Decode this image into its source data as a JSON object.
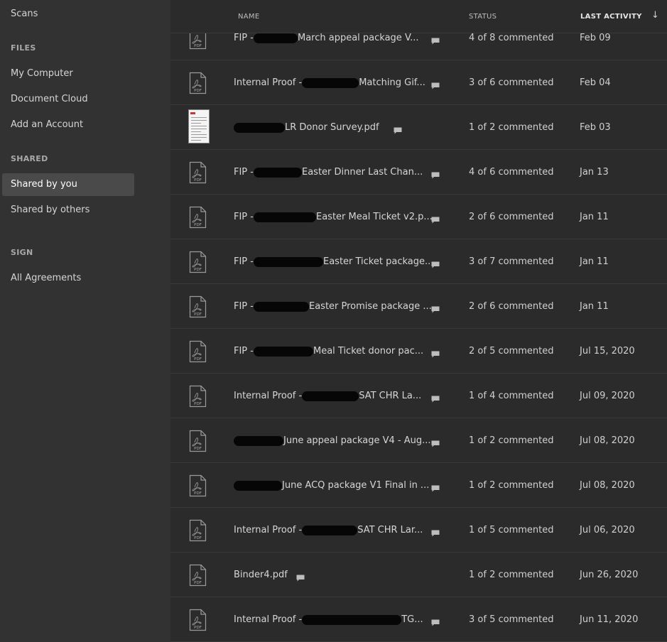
{
  "sidebar": {
    "top_item": "Scans",
    "sections": {
      "files": "FILES",
      "shared": "SHARED",
      "sign": "SIGN"
    },
    "files_items": [
      "My Computer",
      "Document Cloud",
      "Add an Account"
    ],
    "shared_items": [
      "Shared by you",
      "Shared by others"
    ],
    "sign_items": [
      "All Agreements"
    ],
    "active_item": "Shared by you"
  },
  "header": {
    "name": "NAME",
    "status": "STATUS",
    "last_activity": "LAST ACTIVITY",
    "sort_icon": "arrow-down-icon"
  },
  "files": [
    {
      "prefix": "FIP - ",
      "suffix": " March appeal package V...",
      "status": "4 of 8 commented",
      "activity": "Feb 09",
      "thumb": false
    },
    {
      "prefix": "Internal Proof - ",
      "suffix": " Matching Gif...",
      "status": "3 of 6 commented",
      "activity": "Feb 04",
      "thumb": false
    },
    {
      "prefix": "",
      "suffix": " LR Donor Survey.pdf",
      "status": "1 of 2 commented",
      "activity": "Feb 03",
      "thumb": true
    },
    {
      "prefix": "FIP - ",
      "suffix": " Easter Dinner Last Chan...",
      "status": "4 of 6 commented",
      "activity": "Jan 13",
      "thumb": false
    },
    {
      "prefix": "FIP - ",
      "suffix": " Easter Meal Ticket v2.p...",
      "status": "2 of 6 commented",
      "activity": "Jan 11",
      "thumb": false
    },
    {
      "prefix": "FIP - ",
      "suffix": " Easter Ticket package...",
      "status": "3 of 7 commented",
      "activity": "Jan 11",
      "thumb": false
    },
    {
      "prefix": "FIP - ",
      "suffix": " Easter Promise package ...",
      "status": "2 of 6 commented",
      "activity": "Jan 11",
      "thumb": false
    },
    {
      "prefix": "FIP - ",
      "suffix": " Meal Ticket donor pac...",
      "status": "2 of 5 commented",
      "activity": "Jul 15, 2020",
      "thumb": false
    },
    {
      "prefix": "Internal Proof - ",
      "suffix": " SAT CHR La...",
      "status": "1 of 4 commented",
      "activity": "Jul 09, 2020",
      "thumb": false
    },
    {
      "prefix": "",
      "suffix": " June appeal package V4 - Aug...",
      "status": "1 of 2 commented",
      "activity": "Jul 08, 2020",
      "thumb": false
    },
    {
      "prefix": "",
      "suffix": " June ACQ package V1 Final in ...",
      "status": "1 of 2 commented",
      "activity": "Jul 08, 2020",
      "thumb": false
    },
    {
      "prefix": "Internal Proof - ",
      "suffix": " SAT CHR Lar...",
      "status": "1 of 5 commented",
      "activity": "Jul 06, 2020",
      "thumb": false
    },
    {
      "prefix": "Binder4.pdf",
      "suffix": "",
      "status": "1 of 2 commented",
      "activity": "Jun 26, 2020",
      "thumb": false
    },
    {
      "prefix": "Internal Proof - ",
      "suffix": " TG...",
      "status": "3 of 5 commented",
      "activity": "Jun 11, 2020",
      "thumb": false
    }
  ],
  "icons": {
    "pdf_label": "PDF",
    "file_icon": "pdf-file-icon",
    "comment_icon": "comment-icon"
  },
  "colors": {
    "sidebar_bg": "#323232",
    "list_bg": "#2b2b2b",
    "active_item_bg": "#4a4a4a"
  }
}
